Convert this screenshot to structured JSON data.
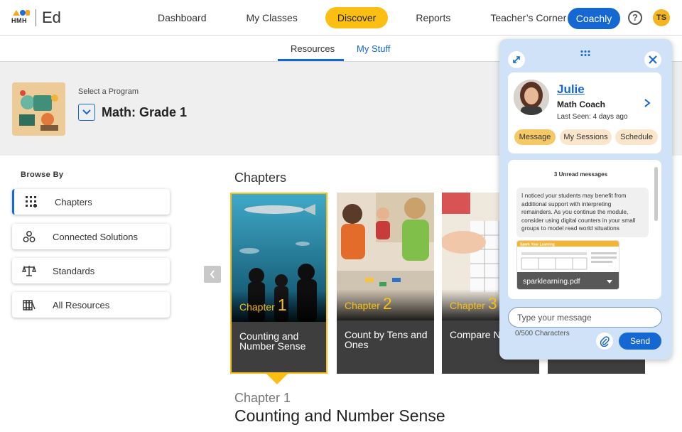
{
  "app": {
    "logo_brand": "HMH",
    "logo_product": "Ed"
  },
  "nav": {
    "items": [
      {
        "label": "Dashboard"
      },
      {
        "label": "My Classes"
      },
      {
        "label": "Discover"
      },
      {
        "label": "Reports"
      },
      {
        "label": "Teacher’s Corner"
      }
    ],
    "active": "Discover",
    "coachly_label": "Coachly",
    "help_icon": "question-circle-icon",
    "user_initials": "TS"
  },
  "subtabs": {
    "resources": "Resources",
    "my_stuff": "My Stuff",
    "active": "Resources"
  },
  "program": {
    "select_label": "Select a Program",
    "title": "Math: Grade 1"
  },
  "browse": {
    "label": "Browse By",
    "items": [
      {
        "label": "Chapters",
        "icon": "grid-plus-icon"
      },
      {
        "label": "Connected Solutions",
        "icon": "connected-circles-icon"
      },
      {
        "label": "Standards",
        "icon": "scale-icon"
      },
      {
        "label": "All Resources",
        "icon": "books-icon"
      }
    ],
    "active": "Chapters"
  },
  "chapters": {
    "title": "Chapters",
    "word": "Chapter",
    "cards": [
      {
        "number": "1",
        "name": "Counting and Number Sense"
      },
      {
        "number": "2",
        "name": "Count by Tens and Ones"
      },
      {
        "number": "3",
        "name": "Compare Numbers"
      }
    ],
    "selected": "1"
  },
  "detail": {
    "chapter_label": "Chapter 1",
    "title": "Counting and Number Sense"
  },
  "coach": {
    "name": "Julie",
    "role": "Math Coach",
    "last_seen": "Last Seen: 4 days ago",
    "tabs": [
      {
        "label": "Message"
      },
      {
        "label": "My Sessions"
      },
      {
        "label": "Schedule"
      }
    ],
    "active_tab": "Message",
    "unread": "3 Unread messages",
    "message": "I noticed your students may benefit from additional support with interpreting remainders. As you continue the module, consider using digital counters in your small groups to model read world situations",
    "attachment_name": "sparklearning.pdf",
    "attachment_heading": "Spark Your Learning",
    "input_placeholder": "Type your message",
    "char_count": "0/500 Characters",
    "send_label": "Send"
  },
  "colors": {
    "accent": "#1567d1",
    "highlight": "#fbbf13",
    "panel": "#cfe2f7"
  }
}
